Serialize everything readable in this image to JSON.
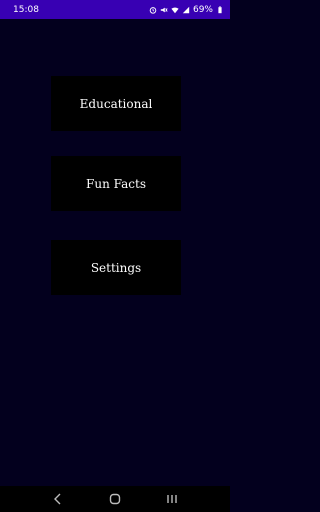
{
  "status_bar": {
    "time": "15:08",
    "battery": "69%"
  },
  "menu": {
    "educational": "Educational",
    "fun_facts": "Fun Facts",
    "settings": "Settings"
  },
  "colors": {
    "status_bar": "#3800b3",
    "background": "#03001e",
    "button": "#000000",
    "text": "#ffffff"
  }
}
